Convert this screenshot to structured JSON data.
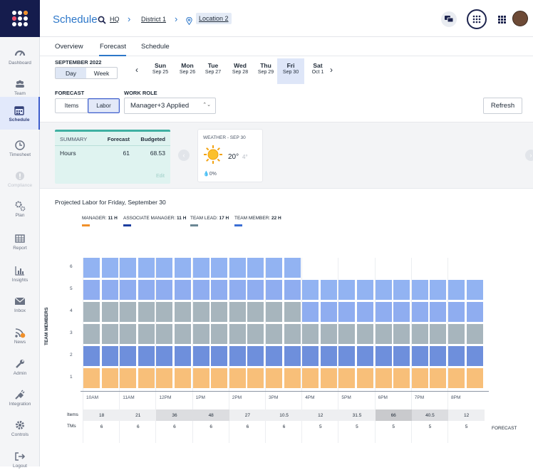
{
  "header": {
    "title": "Schedule",
    "crumbs": [
      "HQ",
      "District 1",
      "Location 2"
    ]
  },
  "sidebar": {
    "items": [
      {
        "label": "Dashboard",
        "icon": "dashboard-icon"
      },
      {
        "label": "Team",
        "icon": "team-icon"
      },
      {
        "label": "Schedule",
        "icon": "calendar-icon",
        "active": true
      },
      {
        "label": "Timesheet",
        "icon": "clock-icon"
      },
      {
        "label": "Compliance",
        "icon": "alert-icon",
        "disabled": true
      },
      {
        "label": "Plan",
        "icon": "gears-icon"
      },
      {
        "label": "Report",
        "icon": "table-icon"
      },
      {
        "label": "Insights",
        "icon": "bar-chart-icon"
      },
      {
        "label": "Inbox",
        "icon": "mail-icon"
      },
      {
        "label": "News",
        "icon": "rss-icon",
        "badge": "!"
      },
      {
        "label": "Admin",
        "icon": "wrench-icon"
      },
      {
        "label": "Integration",
        "icon": "plug-icon"
      },
      {
        "label": "Controls",
        "icon": "cog-icon"
      },
      {
        "label": "Logout",
        "icon": "logout-icon"
      }
    ]
  },
  "tabs": [
    "Overview",
    "Forecast",
    "Schedule"
  ],
  "active_tab": "Forecast",
  "date_nav": {
    "month": "SEPTEMBER 2022",
    "view_day": "Day",
    "view_week": "Week",
    "days": [
      {
        "name": "Sun",
        "date": "Sep 25"
      },
      {
        "name": "Mon",
        "date": "Sep 26"
      },
      {
        "name": "Tue",
        "date": "Sep 27"
      },
      {
        "name": "Wed",
        "date": "Sep 28"
      },
      {
        "name": "Thu",
        "date": "Sep 29"
      },
      {
        "name": "Fri",
        "date": "Sep 30",
        "selected": true
      },
      {
        "name": "Sat",
        "date": "Oct 1"
      }
    ]
  },
  "filters": {
    "forecast_label": "FORECAST",
    "work_role_label": "WORK ROLE",
    "items_btn": "Items",
    "labor_btn": "Labor",
    "role_value": "Manager+3 Applied",
    "refresh": "Refresh"
  },
  "summary": {
    "title": "SUMMARY",
    "col_forecast": "Forecast",
    "col_budgeted": "Budgeted",
    "row_label": "Hours",
    "forecast": "61",
    "budgeted": "68.53",
    "edit": "Edit"
  },
  "weather": {
    "title": "WEATHER - SEP 30",
    "high": "20°",
    "low": "4°",
    "precip": "0%"
  },
  "projection": {
    "title": "Projected Labor for Friday, September 30",
    "yaxis_title": "TEAM MEMBERS",
    "forecast_label": "FORECAST",
    "legend": [
      {
        "name": "MANAGER",
        "value": "11 H",
        "color": "#f0902b"
      },
      {
        "name": "ASSOCIATE MANAGER",
        "value": "11 H",
        "color": "#1d3fa0"
      },
      {
        "name": "TEAM LEAD",
        "value": "17 H",
        "color": "#6b8794"
      },
      {
        "name": "TEAM MEMBER",
        "value": "22 H",
        "color": "#3b6fd4"
      }
    ]
  },
  "chart_data": {
    "type": "bar",
    "stacked": true,
    "title": "Projected Labor for Friday, September 30",
    "ylabel": "TEAM MEMBERS",
    "ylim": [
      0,
      6
    ],
    "yticks": [
      1,
      2,
      3,
      4,
      5,
      6
    ],
    "hours": [
      "10AM",
      "11AM",
      "12PM",
      "1PM",
      "2PM",
      "3PM",
      "4PM",
      "5PM",
      "6PM",
      "7PM",
      "8PM"
    ],
    "slots_per_hour": 2,
    "slot_levels": [
      [
        "#f8bf79",
        "#6e8fdc",
        "#a7b5bd",
        "#a7b5bd",
        "#8fadf0",
        "#92b3f2"
      ],
      [
        "#f8bf79",
        "#6e8fdc",
        "#a7b5bd",
        "#a7b5bd",
        "#8fadf0",
        "#92b3f2"
      ],
      [
        "#f8bf79",
        "#6e8fdc",
        "#a7b5bd",
        "#a7b5bd",
        "#8fadf0",
        "#92b3f2"
      ],
      [
        "#f8bf79",
        "#6e8fdc",
        "#a7b5bd",
        "#a7b5bd",
        "#8fadf0",
        "#92b3f2"
      ],
      [
        "#f8bf79",
        "#6e8fdc",
        "#a7b5bd",
        "#a7b5bd",
        "#8fadf0",
        "#92b3f2"
      ],
      [
        "#f8bf79",
        "#6e8fdc",
        "#a7b5bd",
        "#a7b5bd",
        "#8fadf0",
        "#92b3f2"
      ],
      [
        "#f8bf79",
        "#6e8fdc",
        "#a7b5bd",
        "#a7b5bd",
        "#8fadf0",
        "#92b3f2"
      ],
      [
        "#f8bf79",
        "#6e8fdc",
        "#a7b5bd",
        "#a7b5bd",
        "#8fadf0",
        "#92b3f2"
      ],
      [
        "#f8bf79",
        "#6e8fdc",
        "#a7b5bd",
        "#a7b5bd",
        "#8fadf0",
        "#92b3f2"
      ],
      [
        "#f8bf79",
        "#6e8fdc",
        "#a7b5bd",
        "#a7b5bd",
        "#8fadf0",
        "#92b3f2"
      ],
      [
        "#f8bf79",
        "#6e8fdc",
        "#a7b5bd",
        "#a7b5bd",
        "#8fadf0",
        "#92b3f2"
      ],
      [
        "#f8bf79",
        "#6e8fdc",
        "#a7b5bd",
        "#a7b5bd",
        "#8fadf0",
        "#92b3f2"
      ],
      [
        "#f8bf79",
        "#6e8fdc",
        "#a7b5bd",
        "#8fadf0",
        "#92b3f2"
      ],
      [
        "#f8bf79",
        "#6e8fdc",
        "#a7b5bd",
        "#8fadf0",
        "#92b3f2"
      ],
      [
        "#f8bf79",
        "#6e8fdc",
        "#a7b5bd",
        "#8fadf0",
        "#92b3f2"
      ],
      [
        "#f8bf79",
        "#6e8fdc",
        "#a7b5bd",
        "#8fadf0",
        "#92b3f2"
      ],
      [
        "#f8bf79",
        "#6e8fdc",
        "#a7b5bd",
        "#8fadf0",
        "#92b3f2"
      ],
      [
        "#f8bf79",
        "#6e8fdc",
        "#a7b5bd",
        "#8fadf0",
        "#92b3f2"
      ],
      [
        "#f8bf79",
        "#6e8fdc",
        "#a7b5bd",
        "#8fadf0",
        "#92b3f2"
      ],
      [
        "#f8bf79",
        "#6e8fdc",
        "#a7b5bd",
        "#8fadf0",
        "#92b3f2"
      ],
      [
        "#f8bf79",
        "#6e8fdc",
        "#a7b5bd",
        "#8fadf0",
        "#92b3f2"
      ],
      [
        "#f8bf79",
        "#6e8fdc",
        "#a7b5bd",
        "#8fadf0",
        "#92b3f2"
      ]
    ],
    "items": [
      "18",
      "21",
      "36",
      "48",
      "27",
      "10.5",
      "12",
      "31.5",
      "66",
      "40.5",
      "12"
    ],
    "tms": [
      "6",
      "6",
      "6",
      "6",
      "6",
      "6",
      "5",
      "5",
      "5",
      "5",
      "5"
    ],
    "row_labels": {
      "items": "Items",
      "tms": "TMs"
    }
  }
}
